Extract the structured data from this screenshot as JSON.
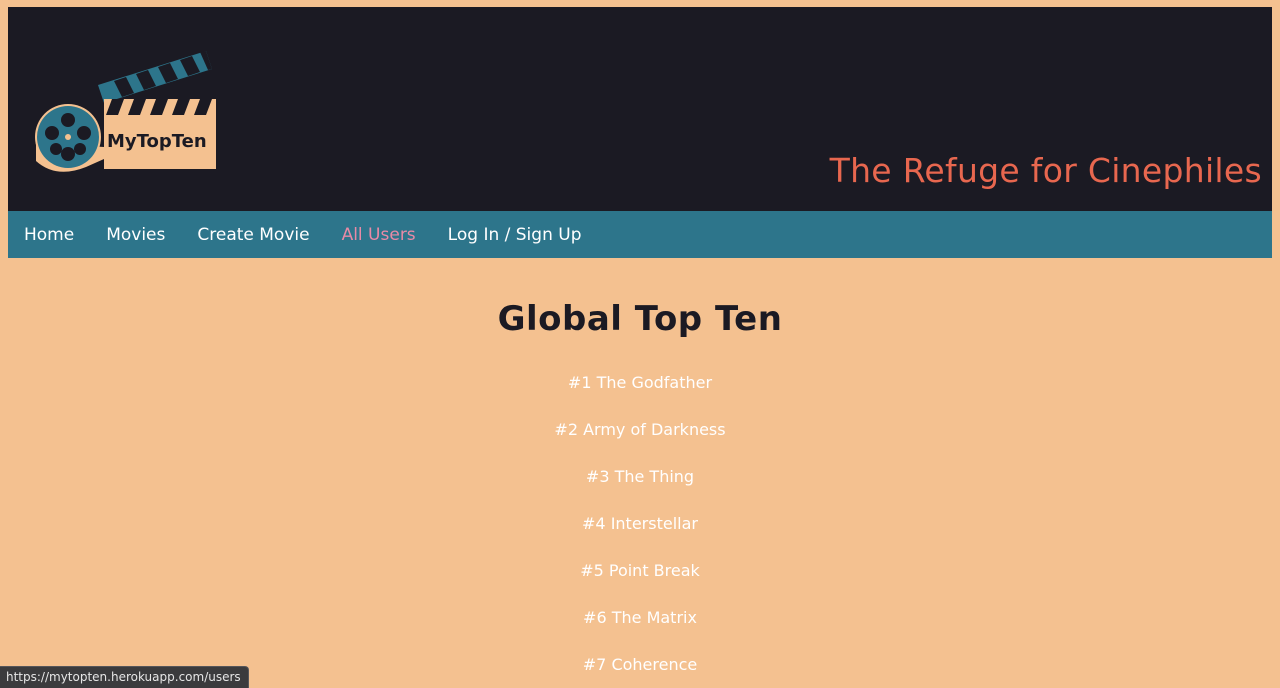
{
  "header": {
    "logo_text": "MyTopTen",
    "tagline": "The Refuge for Cinephiles"
  },
  "nav": {
    "items": [
      {
        "label": "Home"
      },
      {
        "label": "Movies"
      },
      {
        "label": "Create Movie"
      },
      {
        "label": "All Users",
        "active": true
      },
      {
        "label": "Log In / Sign Up"
      }
    ]
  },
  "main": {
    "title": "Global Top Ten",
    "movies": [
      "#1 The Godfather",
      "#2 Army of Darkness",
      "#3 The Thing",
      "#4 Interstellar",
      "#5 Point Break",
      "#6 The Matrix",
      "#7 Coherence"
    ]
  },
  "status_bar": {
    "url": "https://mytopten.herokuapp.com/users"
  },
  "colors": {
    "background": "#f4c190",
    "header": "#1b1a23",
    "nav": "#2d758b",
    "tagline": "#e8674f",
    "active_link": "#e98aa6"
  }
}
